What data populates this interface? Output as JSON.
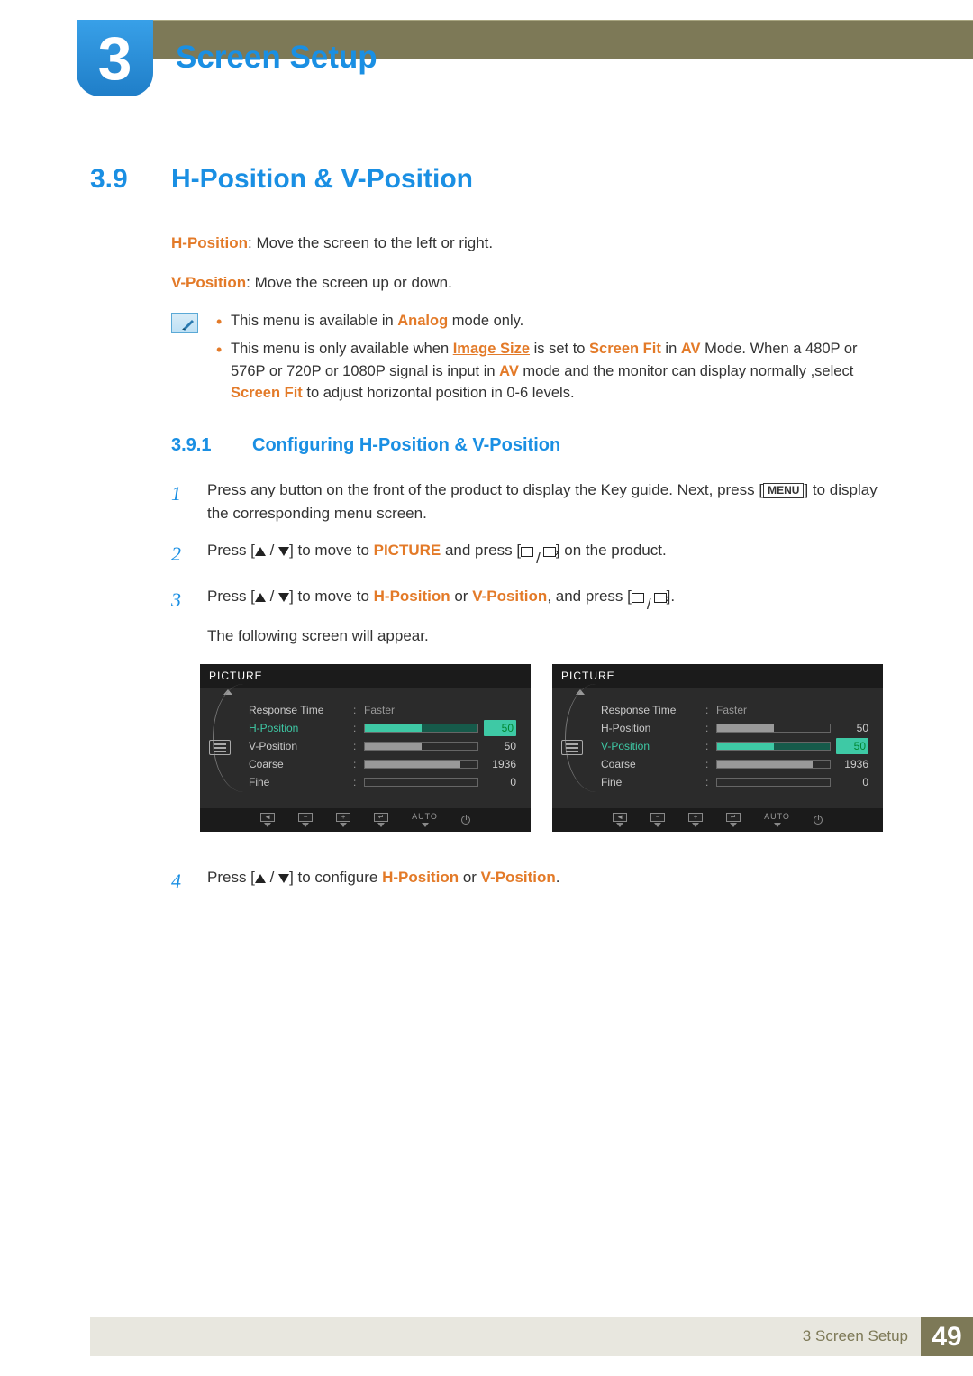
{
  "chapter": {
    "number": "3",
    "title": "Screen Setup"
  },
  "section": {
    "number": "3.9",
    "title": "H-Position & V-Position"
  },
  "definitions": {
    "h_label": "H-Position",
    "h_text": ": Move the screen to the left or right.",
    "v_label": "V-Position",
    "v_text": ": Move the screen up or down."
  },
  "notes": {
    "n1_a": "This menu is available in ",
    "n1_b": "Analog",
    "n1_c": " mode only.",
    "n2_a": "This menu is only available when ",
    "n2_b": "Image Size",
    "n2_c": " is set to ",
    "n2_d": "Screen Fit",
    "n2_e": " in ",
    "n2_f": "AV",
    "n2_g": " Mode. When a 480P or 576P or 720P or 1080P signal is input in ",
    "n2_h": "AV",
    "n2_i": " mode and the monitor can display normally ,select ",
    "n2_j": "Screen Fit",
    "n2_k": " to adjust horizontal position in 0-6 levels."
  },
  "subsection": {
    "number": "3.9.1",
    "title": "Configuring H-Position & V-Position"
  },
  "steps": {
    "s1n": "1",
    "s1a": "Press any button on the front of the product to display the Key guide. Next, press [",
    "s1b": "MENU",
    "s1c": "] to display the corresponding menu screen.",
    "s2n": "2",
    "s2a": "Press [",
    "s2b": "] to move to ",
    "s2c": "PICTURE",
    "s2d": " and press [",
    "s2e": "] on the product.",
    "s3n": "3",
    "s3a": "Press [",
    "s3b": "] to move to ",
    "s3c": "H-Position",
    "s3d": " or ",
    "s3e": "V-Position",
    "s3f": ", and press [",
    "s3g": "].",
    "s3h": "The following screen will appear.",
    "s4n": "4",
    "s4a": "Press [",
    "s4b": "] to configure ",
    "s4c": "H-Position",
    "s4d": " or ",
    "s4e": "V-Position",
    "s4f": "."
  },
  "osd": {
    "title": "PICTURE",
    "rows": {
      "response": "Response Time",
      "response_val": "Faster",
      "hpos": "H-Position",
      "hpos_val": "50",
      "vpos": "V-Position",
      "vpos_val": "50",
      "coarse": "Coarse",
      "coarse_val": "1936",
      "fine": "Fine",
      "fine_val": "0"
    },
    "footer_auto": "AUTO"
  },
  "footer": {
    "label": "3 Screen Setup",
    "page": "49"
  }
}
